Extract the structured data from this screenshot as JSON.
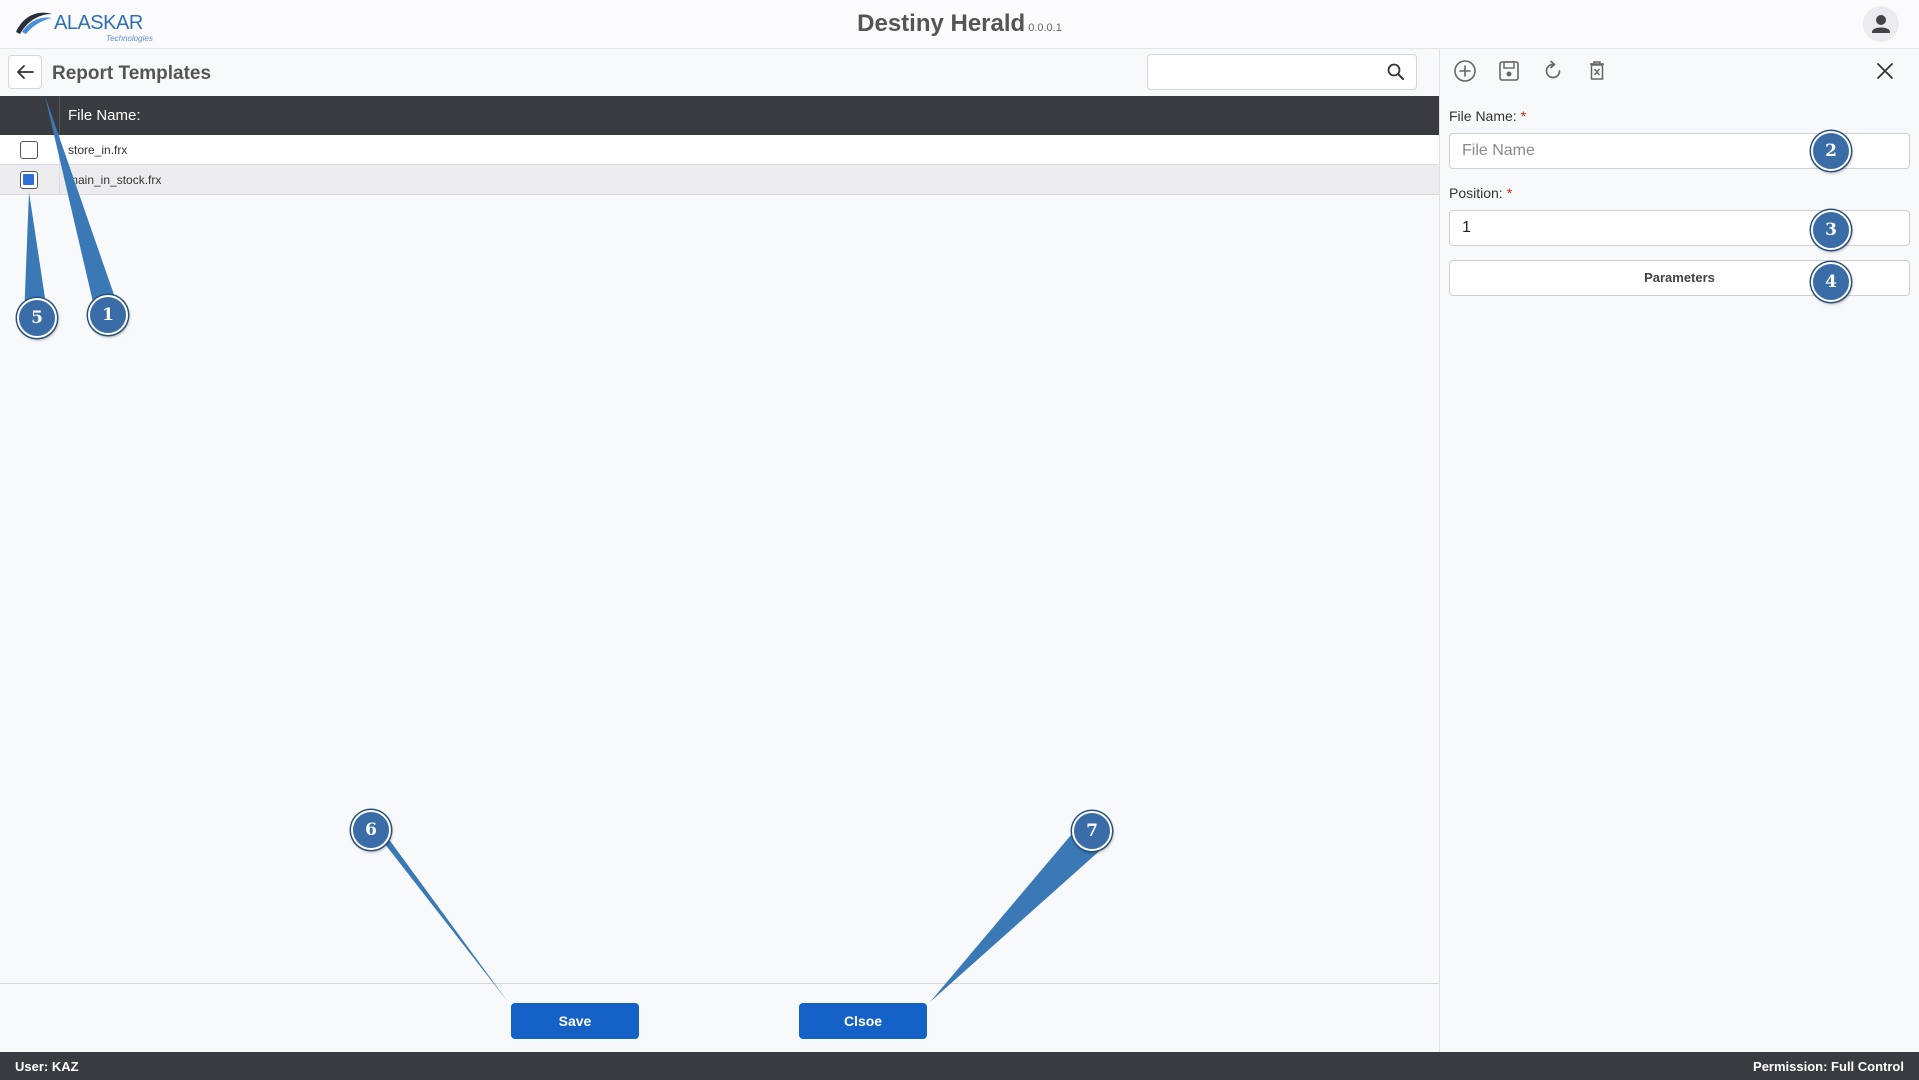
{
  "header": {
    "logo_text": "ALASKAR",
    "logo_sub": "Technologies",
    "title": "Destiny Herald",
    "version": "0.0.0.1"
  },
  "page": {
    "title": "Report Templates",
    "search_placeholder": ""
  },
  "grid": {
    "columns": [
      "File Name:"
    ],
    "rows": [
      {
        "file_name": "store_in.frx",
        "checked": false
      },
      {
        "file_name": "main_in_stock.frx",
        "checked": true
      }
    ]
  },
  "actions": {
    "save_label": "Save",
    "close_label": "Clsoe"
  },
  "form": {
    "toolbar_icons": [
      "add-circle-icon",
      "save-icon",
      "refresh-icon",
      "delete-icon"
    ],
    "file_name_label": "File Name:",
    "file_name_placeholder": "File Name",
    "file_name_value": "",
    "position_label": "Position:",
    "position_value": "1",
    "required_mark": "*",
    "parameters_label": "Parameters"
  },
  "status": {
    "user": "User: KAZ",
    "permission": "Permission: Full Control"
  },
  "callouts": [
    "1",
    "2",
    "3",
    "4",
    "5",
    "6",
    "7"
  ],
  "colors": {
    "primary_button": "#1462c7",
    "header_dark": "#3a3b40",
    "callout": "#3a6da8"
  }
}
